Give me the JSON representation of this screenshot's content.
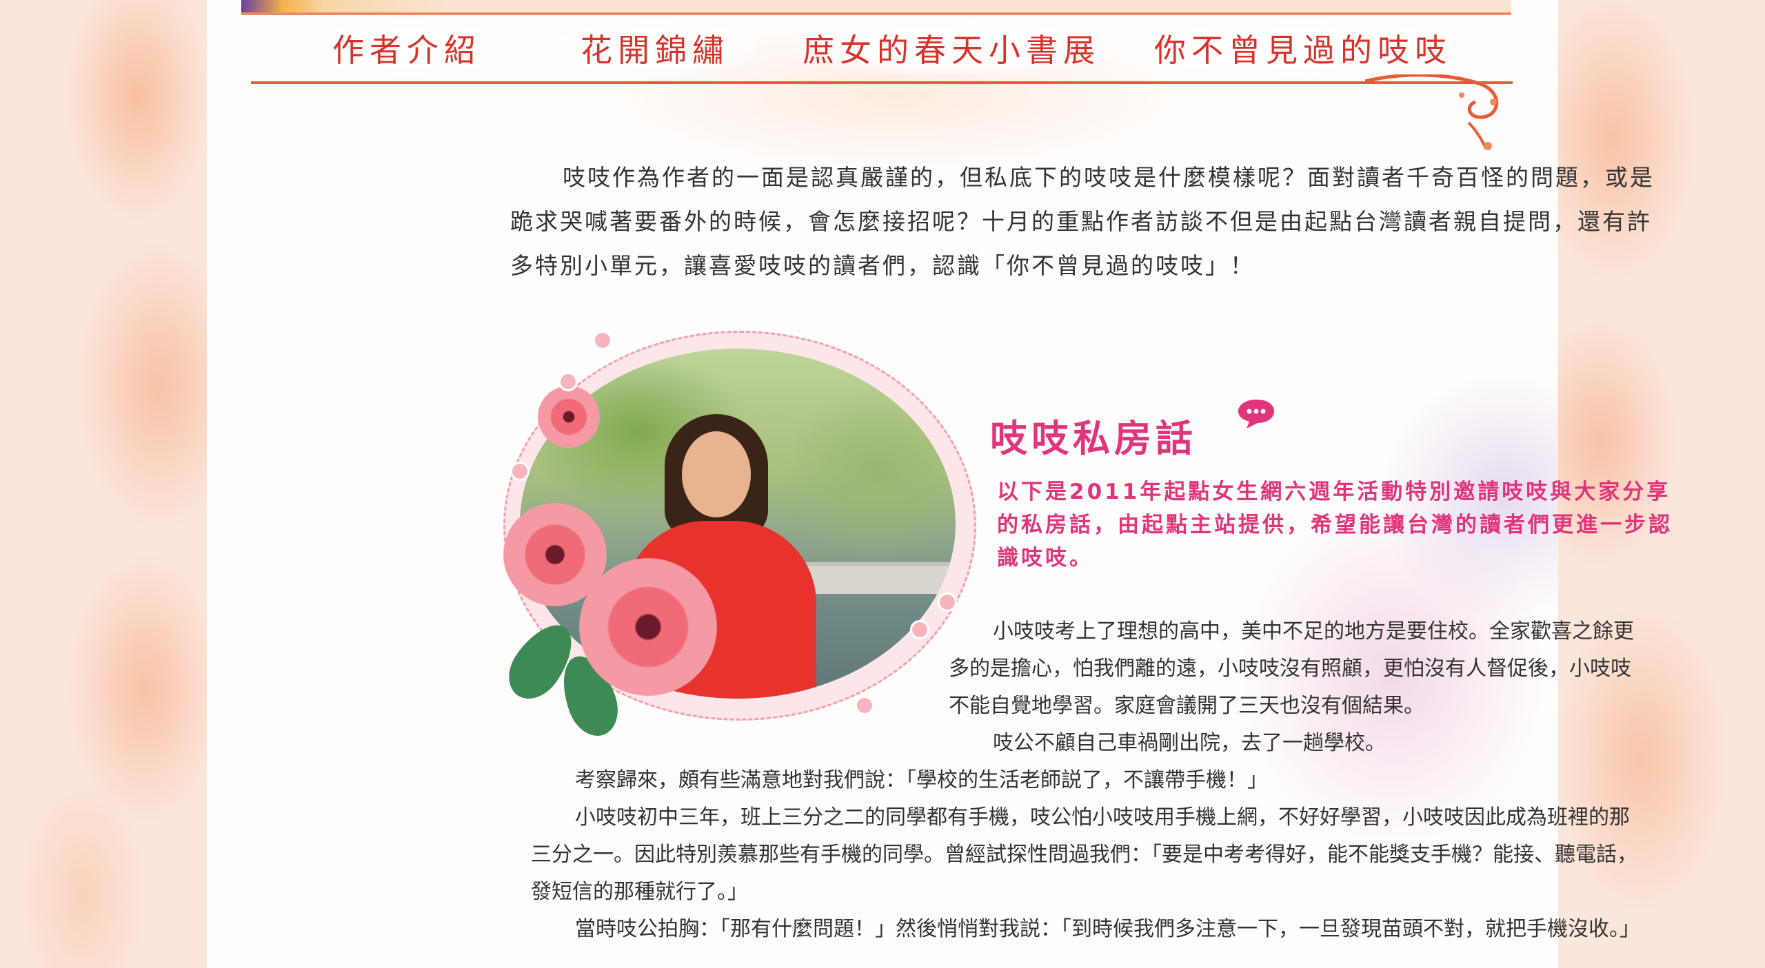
{
  "nav": {
    "items": [
      {
        "label": "作者介紹"
      },
      {
        "label": "花開錦繡"
      },
      {
        "label": "庶女的春天小書展"
      },
      {
        "label": "你不曾見過的吱吱"
      }
    ]
  },
  "intro": {
    "text": "吱吱作為作者的一面是認真嚴謹的，但私底下的吱吱是什麼模樣呢？面對讀者千奇百怪的問題，或是跪求哭喊著要番外的時候，會怎麼接招呢？十月的重點作者訪談不但是由起點台灣讀者親自提問，還有許多特別小單元，讓喜愛吱吱的讀者們，認識「你不曾見過的吱吱」！"
  },
  "private_talk": {
    "title": "吱吱私房話",
    "description": "以下是2011年起點女生網六週年活動特別邀請吱吱與大家分享的私房話，由起點主站提供，希望能讓台灣的讀者們更進一步認識吱吱。"
  },
  "article": {
    "paragraphs": [
      "小吱吱考上了理想的高中，美中不足的地方是要住校。全家歡喜之餘更多的是擔心，怕我們離的遠，小吱吱沒有照顧，更怕沒有人督促後，小吱吱不能自覺地學習。家庭會議開了三天也沒有個結果。",
      "吱公不顧自己車禍剛出院，去了一趟學校。",
      "考察歸來，頗有些滿意地對我們說：「學校的生活老師説了，不讓帶手機！」",
      "小吱吱初中三年，班上三分之二的同學都有手機，吱公怕小吱吱用手機上網，不好好學習，小吱吱因此成為班裡的那三分之一。因此特別羨慕那些有手機的同學。曾經試探性問過我們：「要是中考考得好，能不能獎支手機？能接、聽電話，發短信的那種就行了。」",
      "當時吱公拍胸：「那有什麼問題！」然後悄悄對我説：「到時候我們多注意一下，一旦發現苗頭不對，就把手機沒收。」"
    ]
  },
  "colors": {
    "nav_text": "#d8332a",
    "accent_line": "#e85a3a",
    "heading_pink": "#e0357a",
    "body_text": "#333333"
  }
}
